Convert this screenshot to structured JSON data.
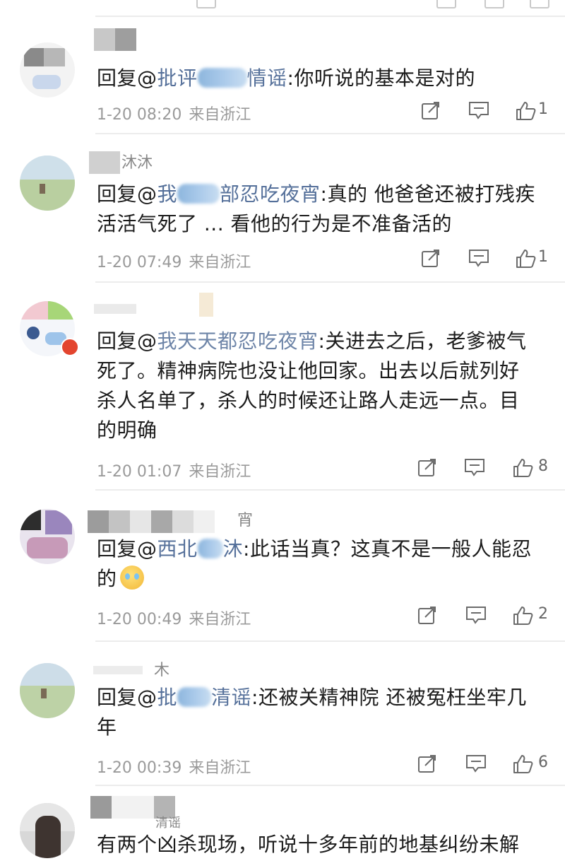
{
  "comments": [
    {
      "name_fragment": "",
      "reply_prefix": "回复@",
      "mention_visible": "批评",
      "mention_tail": "情谣",
      "text": ":你听说的基本是对的",
      "text2": "",
      "timestamp": "1-20 08:20",
      "source": "来自浙江",
      "likes": "1"
    },
    {
      "name_fragment": "沐沐",
      "reply_prefix": "回复@",
      "mention_visible": "我",
      "mention_tail": "部忍吃夜宵",
      "text": ":真的 他爸爸还被打残疾",
      "text2": "活活气死了 ... 看他的行为是不准备活的",
      "timestamp": "1-20 07:49",
      "source": "来自浙江",
      "likes": "1"
    },
    {
      "name_fragment": "",
      "reply_prefix": "回复@",
      "mention_visible": "我天天都忍吃夜宵",
      "mention_tail": "",
      "text": ":关进去之后，老爹被气",
      "text2": "死了。精神病院也没让他回家。出去以后就列好",
      "text3": "杀人名单了，杀人的时候还让路人走远一点。目",
      "text4": "的明确",
      "timestamp": "1-20 01:07",
      "source": "来自浙江",
      "likes": "8"
    },
    {
      "name_fragment": "宵",
      "reply_prefix": "回复@",
      "mention_visible": "西北",
      "mention_tail": "沐",
      "text": ":此话当真？这真不是一般人能忍",
      "text2": "的",
      "timestamp": "1-20 00:49",
      "source": "来自浙江",
      "likes": "2"
    },
    {
      "name_fragment": "木",
      "reply_prefix": "回复@",
      "mention_visible": "批",
      "mention_tail": "清谣",
      "text": ":还被关精神院 还被冤枉坐牢几",
      "text2": "年",
      "timestamp": "1-20 00:39",
      "source": "来自浙江",
      "likes": "6"
    },
    {
      "name_fragment": "清谣",
      "text": "有两个凶杀现场，听说十多年前的地基纠纷未解"
    }
  ],
  "icons": {
    "repost": "repost-icon",
    "comment": "comment-icon",
    "like": "like-icon",
    "emoji": "crying-emoji"
  },
  "colors": {
    "mention": "#55709a",
    "meta": "#9a9a9a",
    "icon": "#6b6b6b",
    "separator": "#ececec"
  }
}
